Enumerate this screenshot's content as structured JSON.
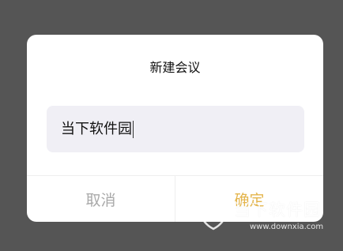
{
  "dialog": {
    "title": "新建会议",
    "input": {
      "value": "当下软件园"
    },
    "buttons": {
      "cancel": "取消",
      "confirm": "确定"
    }
  },
  "watermark": {
    "brand": "当下软件园",
    "url": "www.downxia.com"
  },
  "colors": {
    "overlay": "#555555",
    "confirm": "#e4b54c",
    "cancel": "#a9a9a9",
    "input_bg": "#f0eff5"
  }
}
